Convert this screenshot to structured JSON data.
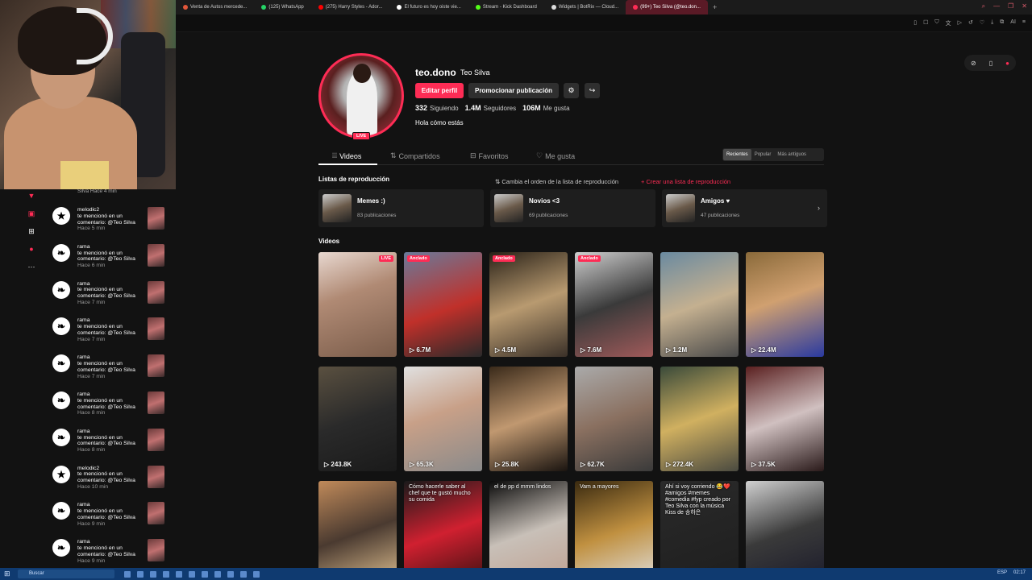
{
  "browser": {
    "tabs": [
      {
        "label": "Venta de Autos mercede...",
        "color": "#e2563a"
      },
      {
        "label": "(125) WhatsApp",
        "color": "#25d366"
      },
      {
        "label": "(275) Harry Styles - Ador...",
        "color": "#ff0000"
      },
      {
        "label": "El futuro es hoy oiste vie...",
        "color": "#ffffff"
      },
      {
        "label": "Stream - Kick Dashboard",
        "color": "#53fc18"
      },
      {
        "label": "Widgets | BotRix — Cloud...",
        "color": "#dddddd"
      },
      {
        "label": "(99+) Teo Silva (@teo.don...",
        "color": "#fe2c55",
        "active": true
      }
    ],
    "new_tab": "+",
    "toolbar_icons": [
      "bookmark-icon",
      "window-icon",
      "shield-icon",
      "translate-icon",
      "play-icon",
      "history-icon",
      "download-icon",
      "extension-icon",
      "ai-icon",
      "menu-icon"
    ],
    "ai_label": "AI"
  },
  "notifications": {
    "top_text": "Silva Hace 4 min",
    "items": [
      {
        "user": "melodic2",
        "text": "te mencionó en un comentario: @Teo Silva",
        "time": "Hace 5 min",
        "icon": "★"
      },
      {
        "user": "rama",
        "text": "te mencionó en un comentario: @Teo Silva",
        "time": "Hace 6 min",
        "icon": "❧"
      },
      {
        "user": "rama",
        "text": "te mencionó en un comentario: @Teo Silva",
        "time": "Hace 7 min",
        "icon": "❧"
      },
      {
        "user": "rama",
        "text": "te mencionó en un comentario: @Teo Silva",
        "time": "Hace 7 min",
        "icon": "❧"
      },
      {
        "user": "rama",
        "text": "te mencionó en un comentario: @Teo Silva",
        "time": "Hace 7 min",
        "icon": "❧"
      },
      {
        "user": "rama",
        "text": "te mencionó en un comentario: @Teo Silva",
        "time": "Hace 8 min",
        "icon": "❧"
      },
      {
        "user": "rama",
        "text": "te mencionó en un comentario: @Teo Silva",
        "time": "Hace 8 min",
        "icon": "❧"
      },
      {
        "user": "melodic2",
        "text": "te mencionó en un comentario: @Teo Silva",
        "time": "Hace 10 min",
        "icon": "★"
      },
      {
        "user": "rama",
        "text": "te mencionó en un comentario: @Teo Silva",
        "time": "Hace 9 min",
        "icon": "❧"
      },
      {
        "user": "rama",
        "text": "te mencionó en un comentario: @Teo Silva",
        "time": "Hace 9 min",
        "icon": "❧"
      }
    ]
  },
  "profile": {
    "username": "teo.dono",
    "display_name": "Teo Silva",
    "live_badge": "LIVE",
    "edit_button": "Editar perfil",
    "promo_button": "Promocionar publicación",
    "stats": [
      {
        "value": "332",
        "label": "Siguiendo"
      },
      {
        "value": "1.4M",
        "label": "Seguidores"
      },
      {
        "value": "106M",
        "label": "Me gusta"
      }
    ],
    "bio": "Hola cómo estás"
  },
  "tabs": [
    {
      "label": "Videos",
      "icon": "⦙⦙⦙",
      "active": true
    },
    {
      "label": "Compartidos",
      "icon": "⇅"
    },
    {
      "label": "Favoritos",
      "icon": "⊟"
    },
    {
      "label": "Me gusta",
      "icon": "♡"
    }
  ],
  "sort": [
    "Recientes",
    "Popular",
    "Más antiguos"
  ],
  "playlists": {
    "title": "Listas de reproducción",
    "reorder": "⇅ Cambia el orden de la lista de reproducción",
    "create": "+ Crear una lista de reproducción",
    "items": [
      {
        "name": "Memes :)",
        "count": "83 publicaciones"
      },
      {
        "name": "Novios <3",
        "count": "69 publicaciones"
      },
      {
        "name": "Amigos ♥",
        "count": "47 publicaciones"
      }
    ]
  },
  "videos": {
    "title": "Videos",
    "items": [
      {
        "views": "",
        "badge": "LIVE",
        "bg": "linear-gradient(160deg,#e8d8d0,#b08a74 40%,#7a5c4a)"
      },
      {
        "views": "6.7M",
        "badge": "Anclado",
        "bg": "linear-gradient(160deg,#6a7a9a,#c0302a 55%,#2a2a2a)"
      },
      {
        "views": "4.5M",
        "badge": "Anclado",
        "bg": "linear-gradient(160deg,#2a2218,#b89a70 50%,#3a3028)"
      },
      {
        "views": "7.6M",
        "badge": "Anclado",
        "bg": "linear-gradient(160deg,#cfcfcf,#3a3a3a 50%,#a05a5a)"
      },
      {
        "views": "1.2M",
        "badge": "",
        "bg": "linear-gradient(160deg,#6a8aa0,#c4b090 50%,#4a4a4a)"
      },
      {
        "views": "22.4M",
        "badge": "",
        "bg": "linear-gradient(160deg,#8a6a3a,#d0a070 45%,#2a3aa0)"
      },
      {
        "views": "243.8K",
        "badge": "",
        "bg": "linear-gradient(160deg,#5a5040,#2a2a2a 50%,#1a1a1a)"
      },
      {
        "views": "65.3K",
        "badge": "",
        "bg": "linear-gradient(160deg,#e0e0e0,#c8a088 45%,#8a8a8a)"
      },
      {
        "views": "25.8K",
        "badge": "",
        "bg": "linear-gradient(160deg,#3a2a1a,#c09870 50%,#1a1410)"
      },
      {
        "views": "62.7K",
        "badge": "",
        "bg": "linear-gradient(160deg,#aaaaaa,#8a7060 50%,#3a3a3a)"
      },
      {
        "views": "272.4K",
        "badge": "",
        "bg": "linear-gradient(160deg,#3a4a3a,#d0b060 50%,#4a4a40)"
      },
      {
        "views": "37.5K",
        "badge": "",
        "bg": "linear-gradient(160deg,#5a2020,#d0c0c0 50%,#2a1a1a)"
      },
      {
        "views": "",
        "badge": "",
        "caption": "",
        "bg": "linear-gradient(160deg,#c08a5a,#4a3a30 50%,#e0c090)"
      },
      {
        "views": "",
        "badge": "",
        "caption": "Cómo hacerle saber al chef que te gustó mucho su comida",
        "bg": "linear-gradient(160deg,#1a1a1a,#d02030 50%,#3a1010)"
      },
      {
        "views": "",
        "badge": "",
        "caption": "el de pp d mmm lindos",
        "bg": "linear-gradient(160deg,#0a0a0a,#c8c0b8 50%,#bfa090)"
      },
      {
        "views": "",
        "badge": "",
        "caption": "Vam a mayores",
        "bg": "linear-gradient(160deg,#3a2a10,#c09040 50%,#e0e0e0)"
      },
      {
        "views": "",
        "badge": "",
        "caption": "Ahí si voy corriendo 😂❤️ #amigos #memes #comedia #fyp creado por Teo Silva con la música Kiss de 송하은",
        "bg": "linear-gradient(160deg,#2a2a2a,#1e1e1e)"
      },
      {
        "views": "",
        "badge": "",
        "bg": "linear-gradient(160deg,#d0d0d0,#3a3a3a 50%,#1a1a2a)"
      }
    ]
  },
  "taskbar": {
    "search": "Buscar",
    "tray": [
      "ESP",
      "02:17"
    ]
  },
  "colors": {
    "accent": "#fe2c55",
    "bg": "#121212"
  }
}
